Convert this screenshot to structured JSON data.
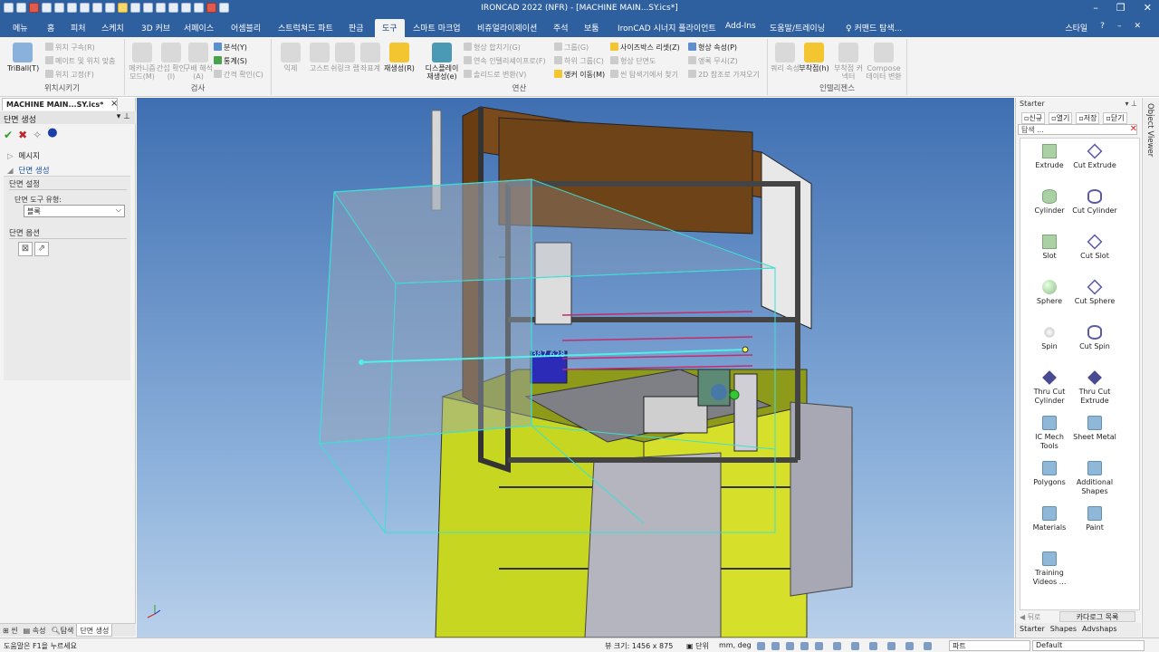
{
  "title": "IRONCAD 2022 (NFR) - [MACHINE MAIN...SY.ics*]",
  "window_controls": {
    "minimize": "–",
    "restore": "❐",
    "close": "✕"
  },
  "menu_tabs": [
    "메뉴",
    "홈",
    "피처",
    "스케치",
    "3D 커브",
    "서페이스",
    "어셈블리",
    "스트럭쳐드 파트",
    "판금",
    "도구",
    "스마트 마크업",
    "비쥬얼라이제이션",
    "주석",
    "보툼",
    "IronCAD 시너지 플라이언트",
    "Add-Ins",
    "도움말/트레이닝",
    "커맨드 탐색..."
  ],
  "active_tab": "도구",
  "tab_right": {
    "style": "스타일",
    "help": "?",
    "min": "–",
    "close": "✕"
  },
  "ribbon": {
    "groups": [
      {
        "label": "위치시키기"
      },
      {
        "label": "검사"
      },
      {
        "label": "연산"
      },
      {
        "label": "인텔리젠스"
      }
    ],
    "triball": "TriBall(T)",
    "pos_small": [
      "위치 구속(R)",
      "메이트 및 위치 맞춤",
      "위치 고정(F)"
    ],
    "inspect_big": [
      "메카니즘 모드(M)",
      "간섭 확인(I)",
      "구배 해석(A)"
    ],
    "inspect_small": [
      "분석(Y)",
      "통계(S)",
      "간격 확인(C)"
    ],
    "ops_big": [
      "익제",
      "고스트",
      "쉬링크 랩",
      "좌표계",
      "재생성(R)",
      "디스플레이 재생성(e)"
    ],
    "ops_small_a": [
      "형상 합치기(G)",
      "연속 인텔리셰이프로(F)",
      "솔리드로 변환(V)"
    ],
    "ops_small_b": [
      "그룹(G)",
      "하위 그룹(C)",
      "앵커 이동(M)"
    ],
    "ops_small_c": [
      "사이즈박스 리셋(Z)",
      "형상 단면도",
      "씬 탐색기에서 찾기"
    ],
    "ops_small_d": [
      "형상 속성(P)",
      "앵록 무시(Z)",
      "2D 참조로 가져오기"
    ],
    "intel_big": [
      "쿼리 속성",
      "부착점(h)",
      "부착점 커넥터",
      "Compose 데이터 변환"
    ]
  },
  "left_panel": {
    "doc_tab": "MACHINE MAIN...SY.ics*",
    "panel_title": "단면 생성",
    "tree": [
      "메시지",
      "단면 생성"
    ],
    "section_settings": "단면 설정",
    "tool_type_label": "단면 도구 유형:",
    "tool_type_value": "블록",
    "section_options": "단면 옵션"
  },
  "left_tabs": [
    "씬",
    "속성",
    "탐색",
    "단면 생성"
  ],
  "viewport": {
    "dimension_label": "387.628"
  },
  "catalog": {
    "title": "Starter",
    "buttons": [
      "신규",
      "열기",
      "저장",
      "닫기"
    ],
    "search_placeholder": "탐색 ...",
    "items": [
      "Extrude",
      "Cut Extrude",
      "Cylinder",
      "Cut Cylinder",
      "Slot",
      "Cut Slot",
      "Sphere",
      "Cut Sphere",
      "Spin",
      "Cut Spin",
      "Thru Cut Cylinder",
      "Thru Cut Extrude",
      "IC Mech Tools",
      "Sheet Metal",
      "Polygons",
      "Additional Shapes",
      "Materials",
      "Paint",
      "Training Videos ..."
    ],
    "nav_back": "◀ 뒤로",
    "catalog_list": "카다로그 목록",
    "tabs": [
      "Starter",
      "Shapes",
      "Advshaps"
    ]
  },
  "object_viewer": "Object Viewer",
  "status": {
    "message": "도움말은 F1을 누르세요",
    "view_size": "뷰 크기: 1456 x 875",
    "unit_label": "단위",
    "unit_value": "mm, deg",
    "part": "파트",
    "default": "Default"
  }
}
